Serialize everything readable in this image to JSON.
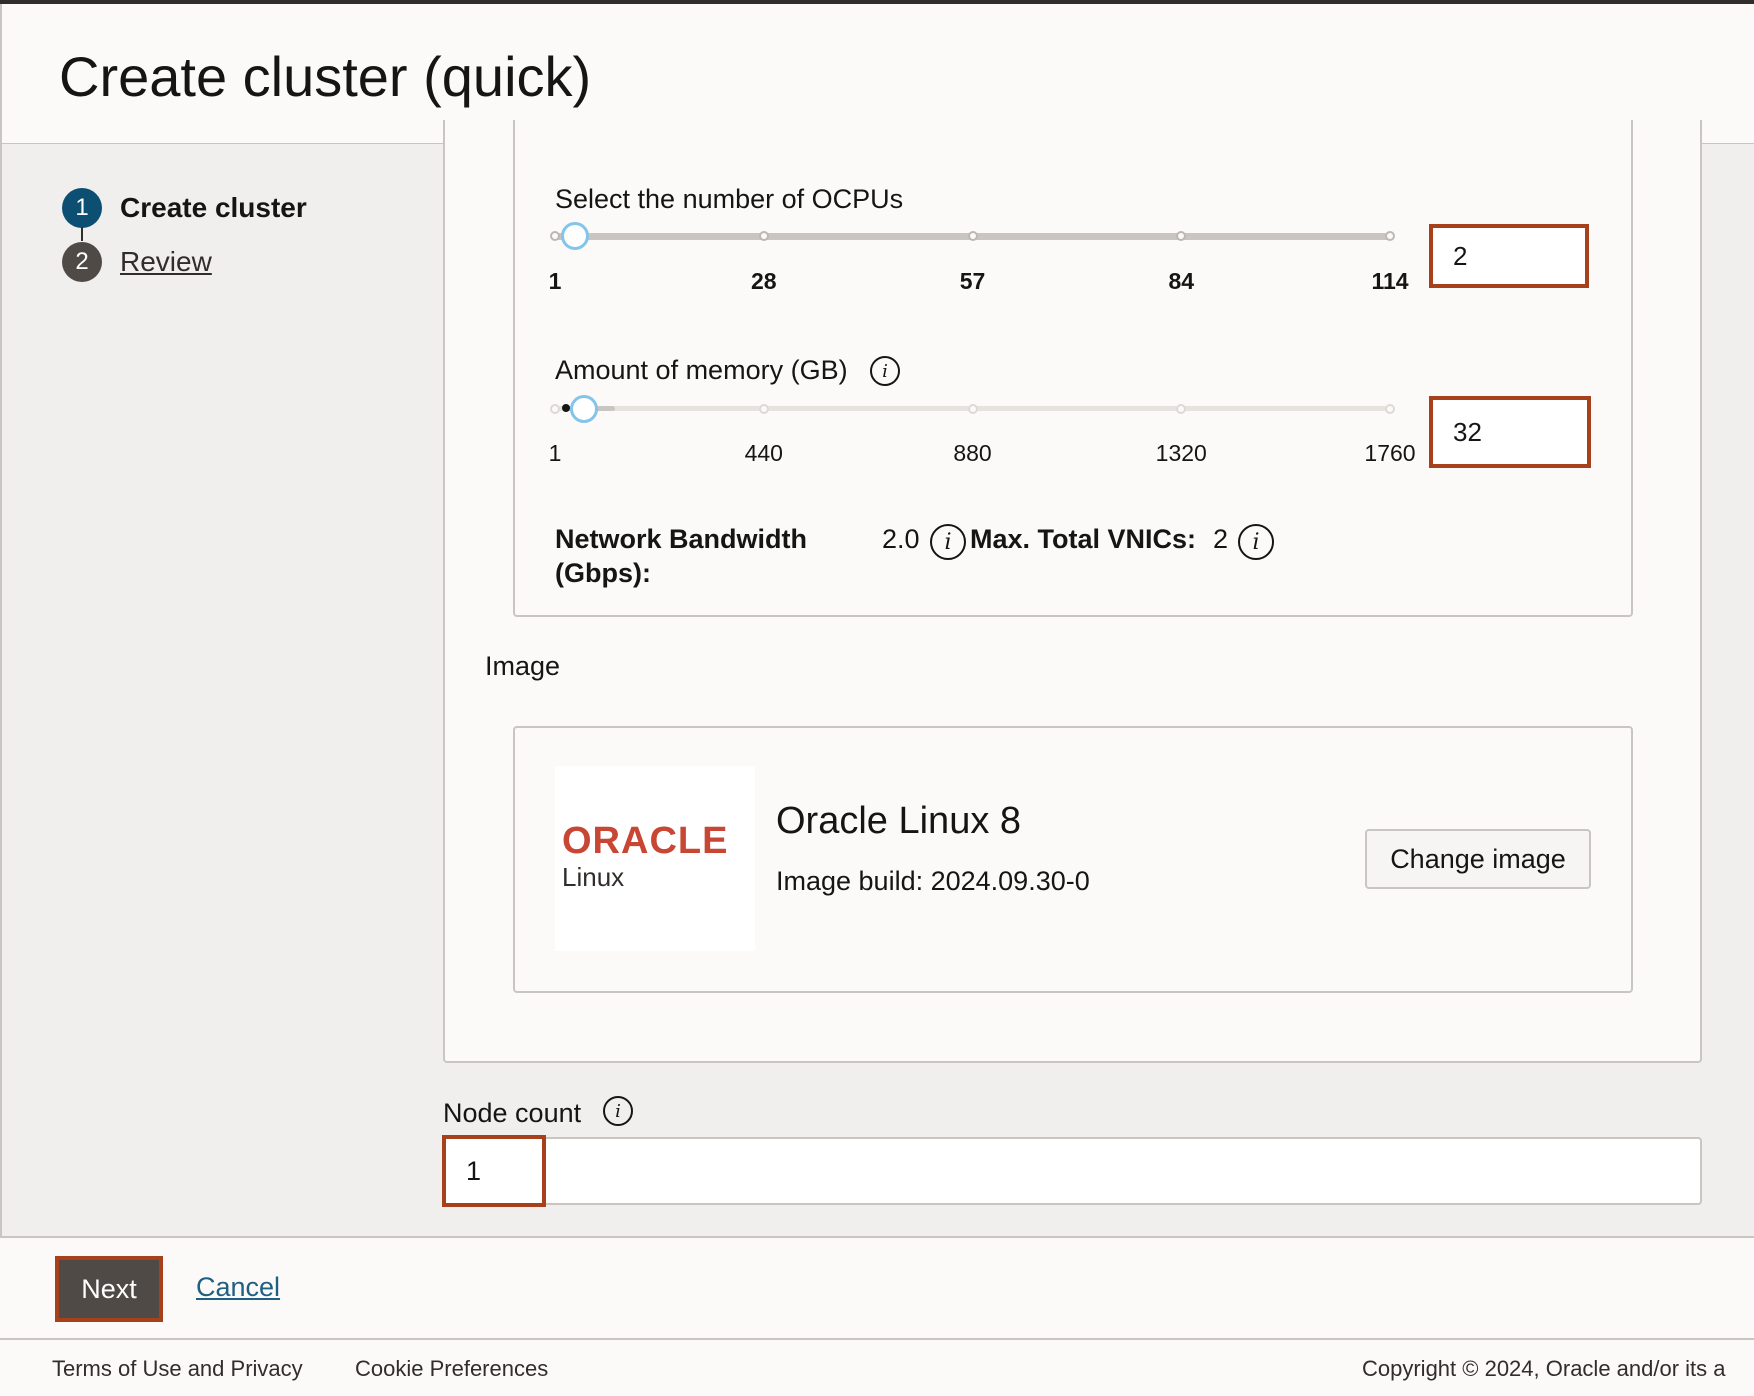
{
  "header": {
    "title": "Create cluster (quick)"
  },
  "steps": [
    {
      "number": "1",
      "label": "Create cluster",
      "state": "current"
    },
    {
      "number": "2",
      "label": "Review",
      "state": "link"
    }
  ],
  "shape": {
    "ocpu": {
      "label": "Select the number of OCPUs",
      "ticks": [
        "1",
        "28",
        "57",
        "84",
        "114"
      ],
      "value": "2",
      "range": [
        1,
        114
      ]
    },
    "memory": {
      "label": "Amount of memory (GB)",
      "ticks": [
        "1",
        "440",
        "880",
        "1320",
        "1760"
      ],
      "value": "32",
      "range": [
        1,
        1760
      ]
    },
    "bandwidth": {
      "label_line1": "Network Bandwidth",
      "label_line2": "(Gbps):",
      "value": "2.0"
    },
    "vnics": {
      "label": "Max. Total VNICs:",
      "value": "2"
    }
  },
  "image": {
    "section_label": "Image",
    "logo_word": "ORACLE",
    "logo_sub": "Linux",
    "name": "Oracle Linux 8",
    "build": "Image build: 2024.09.30-0",
    "change_label": "Change image"
  },
  "node_count": {
    "label": "Node count",
    "value": "1"
  },
  "actions": {
    "next_label": "Next",
    "cancel_label": "Cancel"
  },
  "footer": {
    "terms": "Terms of Use and Privacy",
    "cookies": "Cookie Preferences",
    "copyright": "Copyright © 2024, Oracle and/or its a"
  },
  "colors": {
    "highlight": "#a6411b",
    "step_active": "#0d4f73",
    "step_inactive": "#4f4a46",
    "link": "#1f5f82"
  }
}
